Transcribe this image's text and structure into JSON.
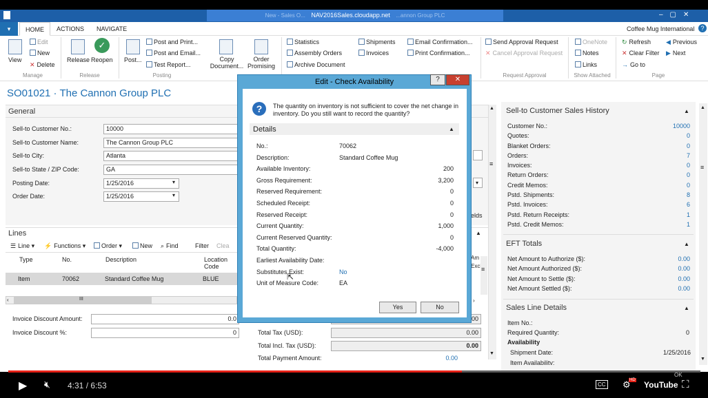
{
  "remote": {
    "title": "NAV2016Sales.cloudapp.net",
    "faded_left": "New - Sales O...",
    "faded_right": "...annon Group PLC"
  },
  "tabs": [
    "HOME",
    "ACTIONS",
    "NAVIGATE"
  ],
  "company": "Coffee Mug International",
  "ribbon": {
    "manage": {
      "view": "View",
      "edit": "Edit",
      "new": "New",
      "delete": "Delete",
      "group": "Manage"
    },
    "release": {
      "release": "Release",
      "reopen": "Reopen",
      "group": "Release"
    },
    "posting": {
      "post": "Post...",
      "post_print": "Post and Print...",
      "post_email": "Post and Email...",
      "test_report": "Test Report...",
      "copy": "Copy Document...",
      "order_promising": "Order Promising",
      "group": "Posting"
    },
    "other": {
      "statistics": "Statistics",
      "assembly": "Assembly Orders",
      "archive": "Archive Document",
      "shipments": "Shipments",
      "invoices": "Invoices",
      "email_conf": "Email Confirmation...",
      "print_conf": "Print Confirmation..."
    },
    "request": {
      "send": "Send Approval Request",
      "cancel": "Cancel Approval Request",
      "group": "Request Approval"
    },
    "attached": {
      "onenote": "OneNote",
      "notes": "Notes",
      "links": "Links",
      "group": "Show Attached"
    },
    "page": {
      "refresh": "Refresh",
      "clear_filter": "Clear Filter",
      "goto": "Go to",
      "previous": "Previous",
      "next": "Next",
      "group": "Page"
    }
  },
  "page_title": "SO01021 · The Cannon Group PLC",
  "general": {
    "title": "General",
    "fields": [
      {
        "label": "Sell-to Customer No.:",
        "value": "10000"
      },
      {
        "label": "Sell-to Customer Name:",
        "value": "The Cannon Group PLC"
      },
      {
        "label": "Sell-to City:",
        "value": "Atlanta"
      },
      {
        "label": "Sell-to State / ZIP Code:",
        "value": "GA"
      },
      {
        "label": "Posting Date:",
        "value": "1/25/2016"
      },
      {
        "label": "Order Date:",
        "value": "1/25/2016"
      }
    ]
  },
  "lines": {
    "title": "Lines",
    "toolbar": [
      "Line",
      "Functions",
      "Order",
      "New",
      "Find",
      "Filter",
      "Clea"
    ],
    "headers": [
      "Type",
      "No.",
      "Description",
      "Location Code"
    ],
    "row": [
      "Item",
      "70062",
      "Standard Coffee Mug",
      "BLUE"
    ],
    "scroll": "III"
  },
  "totals": {
    "inv_disc_amt": "Invoice Discount Amount:",
    "inv_disc_amt_val": "0.0",
    "inv_disc_pct": "Invoice Discount %:",
    "inv_disc_pct_val": "0",
    "total_tax": "Total Tax (USD):",
    "total_tax_val": "0.00",
    "total_incl": "Total Incl. Tax (USD):",
    "total_incl_val": "0.00",
    "total_pay": "Total Payment Amount:",
    "total_pay_val": "0.00",
    "partial_right": "0.00"
  },
  "history": {
    "title": "Sell-to Customer Sales History",
    "rows": [
      {
        "label": "Customer No.:",
        "value": "10000"
      },
      {
        "label": "Quotes:",
        "value": "0"
      },
      {
        "label": "Blanket Orders:",
        "value": "0"
      },
      {
        "label": "Orders:",
        "value": "7"
      },
      {
        "label": "Invoices:",
        "value": "0"
      },
      {
        "label": "Return Orders:",
        "value": "0"
      },
      {
        "label": "Credit Memos:",
        "value": "0"
      },
      {
        "label": "Pstd. Shipments:",
        "value": "8"
      },
      {
        "label": "Pstd. Invoices:",
        "value": "6"
      },
      {
        "label": "Pstd. Return Receipts:",
        "value": "1"
      },
      {
        "label": "Pstd. Credit Memos:",
        "value": "1"
      }
    ]
  },
  "eft": {
    "title": "EFT Totals",
    "rows": [
      {
        "label": "Net Amount to Authorize ($):",
        "value": "0.00"
      },
      {
        "label": "Net Amount Authorized ($):",
        "value": "0.00"
      },
      {
        "label": "Net Amount to Settle ($):",
        "value": "0.00"
      },
      {
        "label": "Net Amount Settled ($):",
        "value": "0.00"
      }
    ]
  },
  "sales_line": {
    "title": "Sales Line Details",
    "item_no": "Item No.:",
    "req_qty": "Required Quantity:",
    "req_qty_val": "0",
    "availability": "Availability",
    "ship_date": "Shipment Date:",
    "ship_date_val": "1/25/2016",
    "item_avail": "Item Availability:"
  },
  "dialog": {
    "title": "Edit - Check Availability",
    "help": "?",
    "close": "✕",
    "message": "The quantity on inventory is not sufficient to cover the net change in inventory. Do you still want to record the quantity?",
    "details": "Details",
    "rows": [
      {
        "label": "No.:",
        "value": "70062",
        "align": "left"
      },
      {
        "label": "Description:",
        "value": "Standard Coffee Mug",
        "align": "left"
      },
      {
        "label": "Available Inventory:",
        "value": "200",
        "align": "right"
      },
      {
        "label": "Gross Requirement:",
        "value": "3,200",
        "align": "right"
      },
      {
        "label": "Reserved Requirement:",
        "value": "0",
        "align": "right"
      },
      {
        "label": "Scheduled Receipt:",
        "value": "0",
        "align": "right"
      },
      {
        "label": "Reserved Receipt:",
        "value": "0",
        "align": "right"
      },
      {
        "label": "Current Quantity:",
        "value": "1,000",
        "align": "right"
      },
      {
        "label": "Current Reserved Quantity:",
        "value": "0",
        "align": "right"
      },
      {
        "label": "Total Quantity:",
        "value": "-4,000",
        "align": "right"
      },
      {
        "label": "Earliest Availability Date:",
        "value": "",
        "align": "left"
      },
      {
        "label": "Substitutes Exist:",
        "value": "No",
        "align": "left"
      },
      {
        "label": "Unit of Measure Code:",
        "value": "EA",
        "align": "left"
      }
    ],
    "yes": "Yes",
    "no": "No"
  },
  "partials": {
    "fields": "elds",
    "am": "Am",
    "excl": "Excl",
    "ok": "OK"
  },
  "player": {
    "time": "4:31 / 6:53",
    "progress": 0.655,
    "youtube": "YouTube",
    "cc": "CC",
    "hd": "HD"
  }
}
